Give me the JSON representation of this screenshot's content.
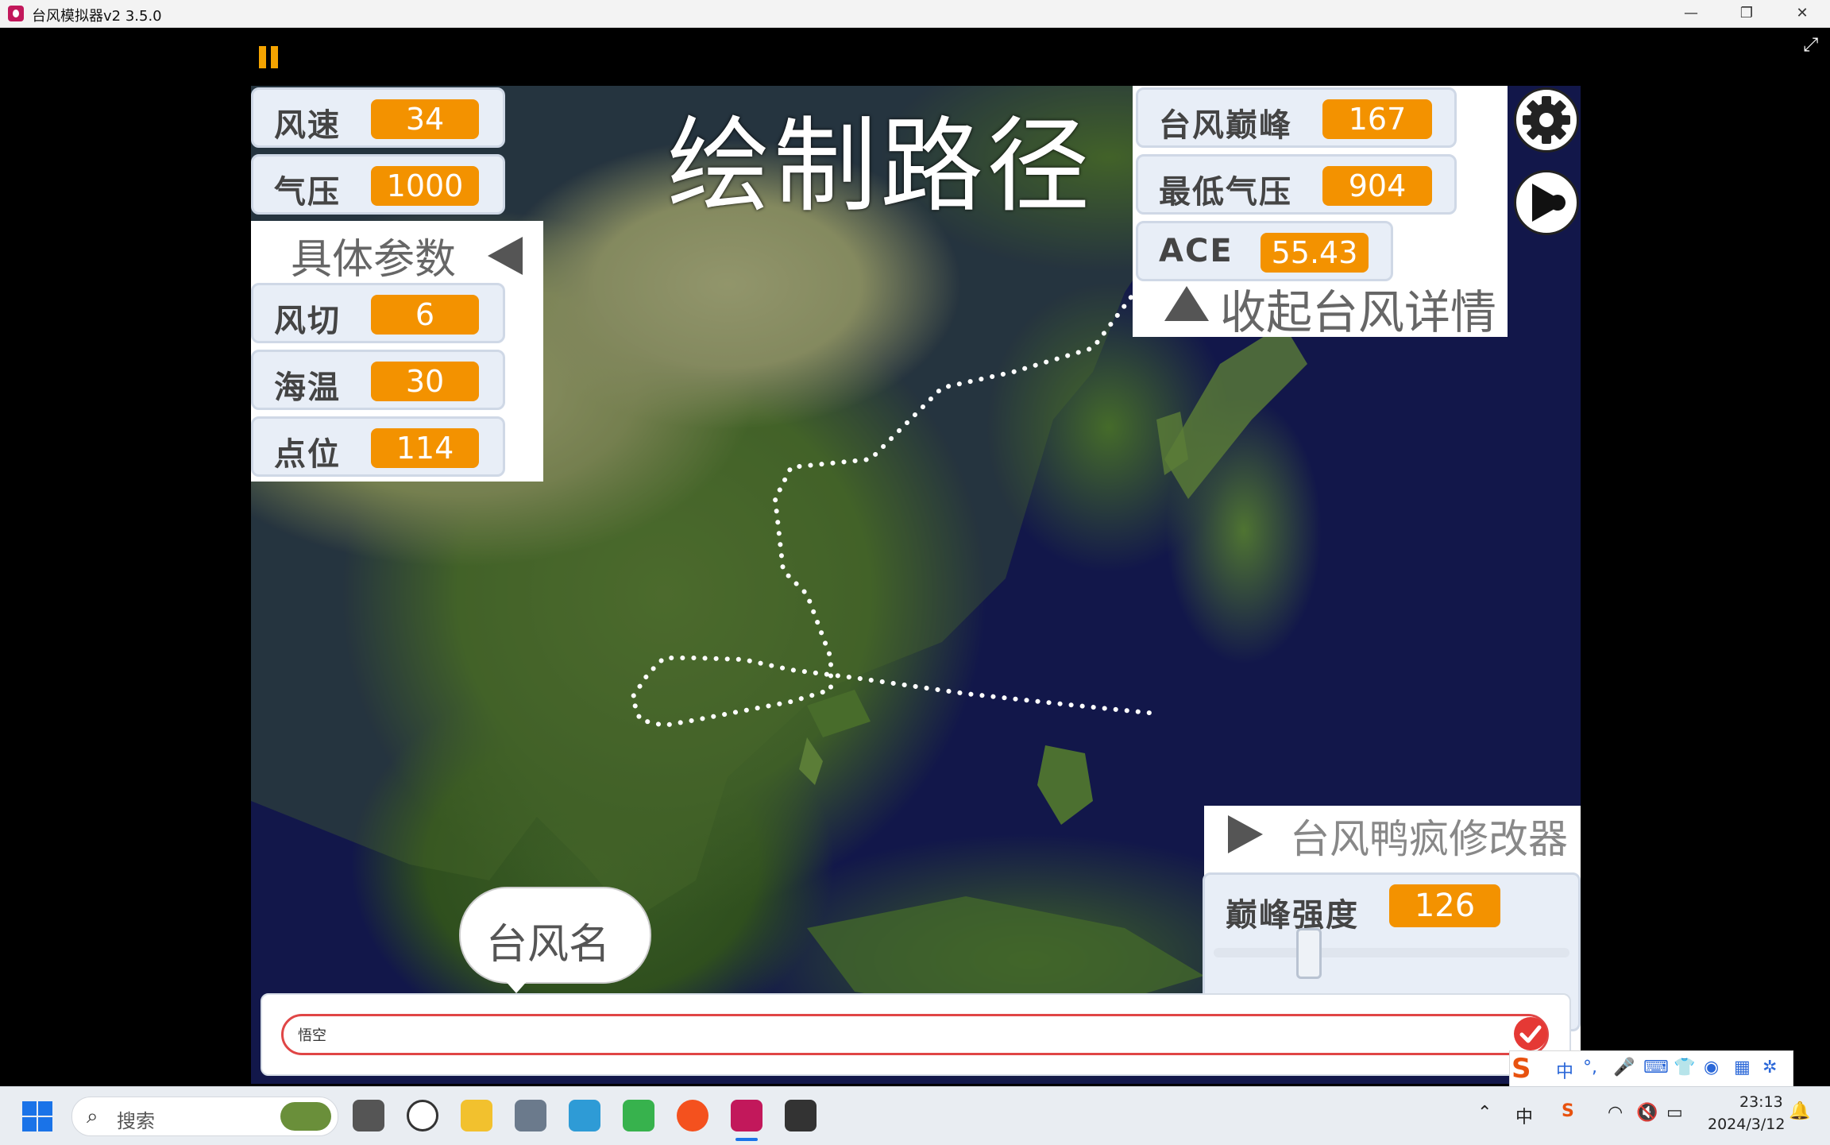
{
  "window": {
    "title": "台风模拟器v2 3.5.0",
    "minimize": "—",
    "restore": "❐",
    "close": "✕"
  },
  "stage": {
    "big_title": "绘制路径",
    "fullscreen_glyph": "⤢"
  },
  "params": [
    {
      "label": "风速",
      "value": "34"
    },
    {
      "label": "气压",
      "value": "1000"
    }
  ],
  "detail_params": {
    "header": "具体参数",
    "items": [
      {
        "label": "风切",
        "value": "6"
      },
      {
        "label": "海温",
        "value": "30"
      },
      {
        "label": "点位",
        "value": "114"
      }
    ]
  },
  "typhoon_stats": [
    {
      "label": "台风巅峰",
      "value": "167"
    },
    {
      "label": "最低气压",
      "value": "904"
    },
    {
      "label": "ACE",
      "value": "55.43"
    }
  ],
  "collapse_label": "收起台风详情",
  "modifier": {
    "header": "台风鸭疯修改器",
    "peak_label": "巅峰强度",
    "peak_value": "126",
    "slider_fraction": 0.2
  },
  "name_bubble": "台风名",
  "name_input": {
    "value": "悟空"
  },
  "ime": {
    "mode": "中",
    "punct": "°,"
  },
  "taskbar": {
    "search_placeholder": "搜索",
    "time": "23:13",
    "date": "2024/3/12",
    "ime_indicator": "中"
  },
  "icons": [
    "pause-icon",
    "fullscreen-icon",
    "gear-icon",
    "play-sound-icon",
    "check-icon",
    "windows-start-icon",
    "search-icon"
  ],
  "colors": {
    "value_badge": "#f39200",
    "input_border": "#e04646",
    "pause": "#f5a400"
  }
}
